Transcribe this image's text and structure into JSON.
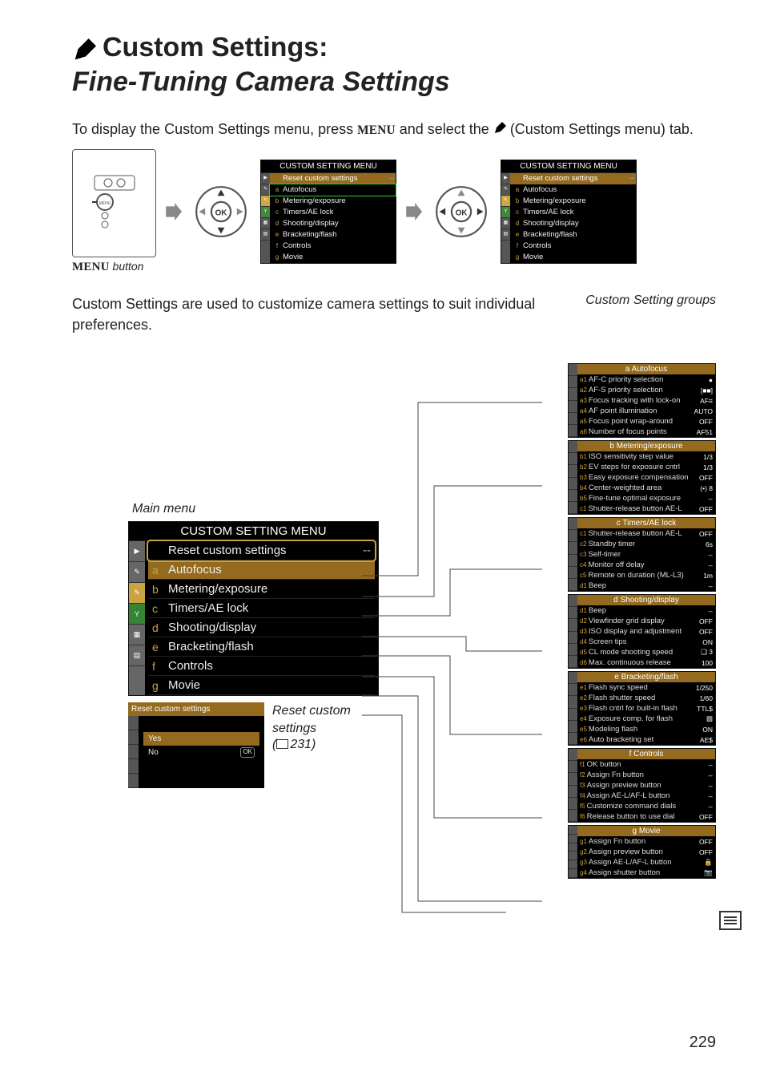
{
  "page": {
    "number": "229",
    "title_line1": "Custom Settings:",
    "title_line2": "Fine-Tuning Camera Settings",
    "intro_pre": "To display the Custom Settings menu, press ",
    "intro_menu": "MENU",
    "intro_mid": " and select the ",
    "intro_post": " (Custom Settings menu) tab.",
    "menu_button_caption_pre": "MENU",
    "menu_button_caption_post": " button",
    "body_para": "Custom Settings are used to customize camera settings to suit individual preferences.",
    "groups_label": "Custom Setting groups",
    "mainmenu_label": "Main menu",
    "reset_caption_line1": "Reset custom",
    "reset_caption_line2": "settings",
    "reset_ref": "231"
  },
  "lcd": {
    "title": "CUSTOM SETTING MENU",
    "rows": [
      {
        "pre": "",
        "txt": "Reset custom settings",
        "val": "--",
        "sel": true
      },
      {
        "pre": "a",
        "txt": "Autofocus"
      },
      {
        "pre": "b",
        "txt": "Metering/exposure"
      },
      {
        "pre": "c",
        "txt": "Timers/AE lock"
      },
      {
        "pre": "d",
        "txt": "Shooting/display"
      },
      {
        "pre": "e",
        "txt": "Bracketing/flash"
      },
      {
        "pre": "f",
        "txt": "Controls"
      },
      {
        "pre": "g",
        "txt": "Movie"
      }
    ]
  },
  "bigmenu": {
    "title": "CUSTOM SETTING MENU",
    "rows": [
      {
        "pre": "",
        "txt": "Reset custom settings",
        "val": "--",
        "selected": true
      },
      {
        "pre": "a",
        "txt": "Autofocus",
        "hl": true
      },
      {
        "pre": "b",
        "txt": "Metering/exposure"
      },
      {
        "pre": "c",
        "txt": "Timers/AE lock"
      },
      {
        "pre": "d",
        "txt": "Shooting/display"
      },
      {
        "pre": "e",
        "txt": "Bracketing/flash"
      },
      {
        "pre": "f",
        "txt": "Controls"
      },
      {
        "pre": "g",
        "txt": "Movie"
      }
    ]
  },
  "reset_lcd": {
    "title": "Reset custom settings",
    "yes": "Yes",
    "no": "No",
    "ok": "OK"
  },
  "groups": [
    {
      "title": "a  Autofocus",
      "rows": [
        {
          "pre": "a1",
          "txt": "AF-C priority selection",
          "v": "●"
        },
        {
          "pre": "a2",
          "txt": "AF-S priority selection",
          "v": "[■■]"
        },
        {
          "pre": "a3",
          "txt": "Focus tracking with lock-on",
          "v": "AF≡"
        },
        {
          "pre": "a4",
          "txt": "AF point illumination",
          "v": "AUTO"
        },
        {
          "pre": "a5",
          "txt": "Focus point wrap-around",
          "v": "OFF"
        },
        {
          "pre": "a6",
          "txt": "Number of focus points",
          "v": "AF51"
        }
      ]
    },
    {
      "title": "b  Metering/exposure",
      "rows": [
        {
          "pre": "b1",
          "txt": "ISO sensitivity step value",
          "v": "1/3"
        },
        {
          "pre": "b2",
          "txt": "EV steps for exposure cntrl",
          "v": "1/3"
        },
        {
          "pre": "b3",
          "txt": "Easy exposure compensation",
          "v": "OFF"
        },
        {
          "pre": "b4",
          "txt": "Center-weighted area",
          "v": "(•) 8"
        },
        {
          "pre": "b5",
          "txt": "Fine-tune optimal exposure",
          "v": "--"
        },
        {
          "pre": "c1",
          "txt": "Shutter-release button AE-L",
          "v": "OFF"
        }
      ]
    },
    {
      "title": "c  Timers/AE lock",
      "rows": [
        {
          "pre": "c1",
          "txt": "Shutter-release button AE-L",
          "v": "OFF"
        },
        {
          "pre": "c2",
          "txt": "Standby timer",
          "v": "6s"
        },
        {
          "pre": "c3",
          "txt": "Self-timer",
          "v": "--"
        },
        {
          "pre": "c4",
          "txt": "Monitor off delay",
          "v": "--"
        },
        {
          "pre": "c5",
          "txt": "Remote on duration (ML-L3)",
          "v": "1m"
        },
        {
          "pre": "d1",
          "txt": "Beep",
          "v": "--"
        }
      ]
    },
    {
      "title": "d  Shooting/display",
      "rows": [
        {
          "pre": "d1",
          "txt": "Beep",
          "v": "--"
        },
        {
          "pre": "d2",
          "txt": "Viewfinder grid display",
          "v": "OFF"
        },
        {
          "pre": "d3",
          "txt": "ISO display and adjustment",
          "v": "OFF"
        },
        {
          "pre": "d4",
          "txt": "Screen tips",
          "v": "ON"
        },
        {
          "pre": "d5",
          "txt": "CL mode shooting speed",
          "v": "❑ 3"
        },
        {
          "pre": "d6",
          "txt": "Max. continuous release",
          "v": "100"
        }
      ]
    },
    {
      "title": "e  Bracketing/flash",
      "rows": [
        {
          "pre": "e1",
          "txt": "Flash sync speed",
          "v": "1/250"
        },
        {
          "pre": "e2",
          "txt": "Flash shutter speed",
          "v": "1/60"
        },
        {
          "pre": "e3",
          "txt": "Flash cntrl for built-in flash",
          "v": "TTL$"
        },
        {
          "pre": "e4",
          "txt": "Exposure comp. for flash",
          "v": "▨"
        },
        {
          "pre": "e5",
          "txt": "Modeling flash",
          "v": "ON"
        },
        {
          "pre": "e6",
          "txt": "Auto bracketing set",
          "v": "AE$"
        }
      ]
    },
    {
      "title": "f  Controls",
      "rows": [
        {
          "pre": "f1",
          "txt": "OK button",
          "v": "--"
        },
        {
          "pre": "f2",
          "txt": "Assign Fn button",
          "v": "--"
        },
        {
          "pre": "f3",
          "txt": "Assign preview button",
          "v": "--"
        },
        {
          "pre": "f4",
          "txt": "Assign AE-L/AF-L button",
          "v": "--"
        },
        {
          "pre": "f5",
          "txt": "Customize command dials",
          "v": "--"
        },
        {
          "pre": "f6",
          "txt": "Release button to use dial",
          "v": "OFF"
        }
      ]
    },
    {
      "title": "g  Movie",
      "rows": [
        {
          "pre": "g1",
          "txt": "Assign Fn button",
          "v": "OFF"
        },
        {
          "pre": "g2",
          "txt": "Assign preview button",
          "v": "OFF"
        },
        {
          "pre": "g3",
          "txt": "Assign AE-L/AF-L button",
          "v": "🔒"
        },
        {
          "pre": "g4",
          "txt": "Assign shutter button",
          "v": "📷"
        }
      ]
    }
  ]
}
